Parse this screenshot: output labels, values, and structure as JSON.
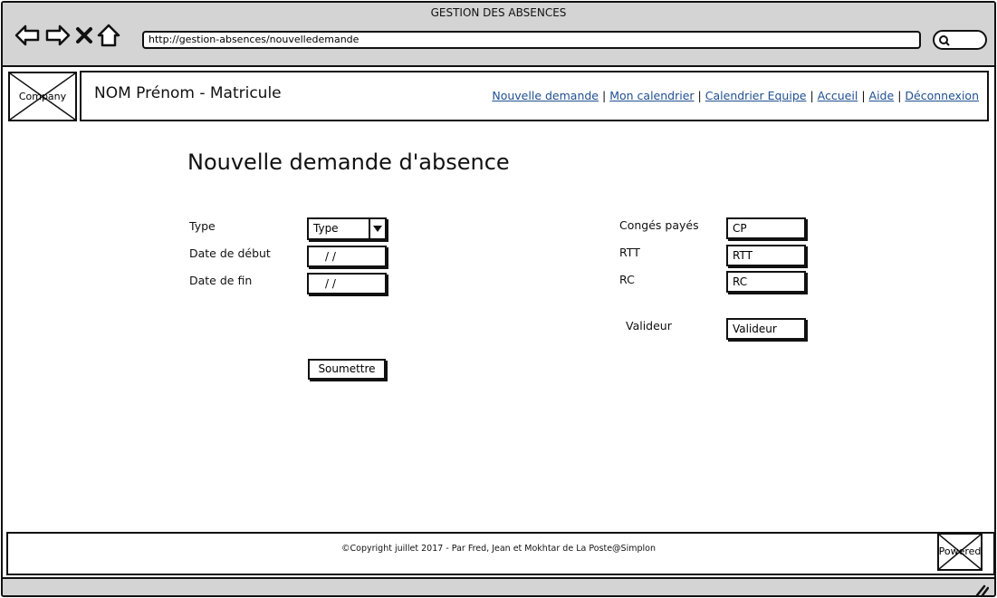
{
  "window": {
    "title": "GESTION DES ABSENCES",
    "url": "http://gestion-absences/nouvelledemande"
  },
  "icons": {
    "back": "arrow-left-icon",
    "forward": "arrow-right-icon",
    "stop": "close-icon",
    "home": "home-icon",
    "search": "search-icon",
    "resize": "resize-grip-icon",
    "logo": "image-placeholder-icon",
    "powered": "image-placeholder-icon"
  },
  "header": {
    "logo_label": "Company",
    "user": "NOM Prénom - Matricule",
    "links": [
      {
        "label": "Nouvelle demande"
      },
      {
        "label": "Mon calendrier"
      },
      {
        "label": "Calendrier Equipe"
      },
      {
        "label": "Accueil"
      },
      {
        "label": "Aide"
      },
      {
        "label": "Déconnexion"
      }
    ],
    "separator": "|"
  },
  "form": {
    "title": "Nouvelle demande d'absence",
    "type_label": "Type",
    "type_value": "Type",
    "start_label": "Date de début",
    "start_value": "/ /",
    "end_label": "Date de fin",
    "end_value": "/ /",
    "cp_label": "Congés payés",
    "cp_value": "CP",
    "rtt_label": "RTT",
    "rtt_value": "RTT",
    "rc_label": "RC",
    "rc_value": "RC",
    "validator_label": "Valideur",
    "validator_value": "Valideur",
    "submit_label": "Soumettre"
  },
  "footer": {
    "copyright": "©Copyright juillet 2017 - Par Fred, Jean et Mokhtar de La Poste@Simplon",
    "powered_label": "Powered"
  },
  "colors": {
    "chrome": "#d4d4d4",
    "link": "#1f4f8f",
    "border": "#111111"
  }
}
